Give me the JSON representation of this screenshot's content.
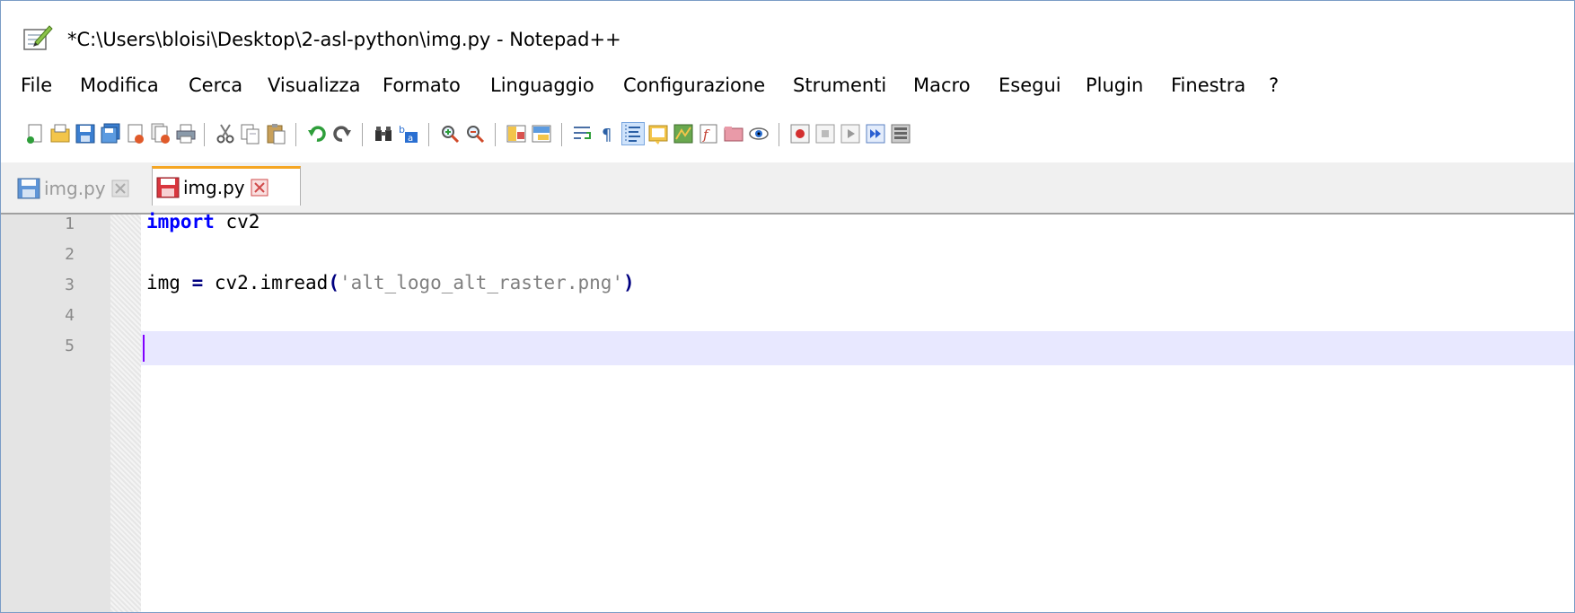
{
  "window": {
    "title": "*C:\\Users\\bloisi\\Desktop\\2-asl-python\\img.py - Notepad++"
  },
  "menu": {
    "items": [
      "File",
      "Modifica",
      "Cerca",
      "Visualizza",
      "Formato",
      "Linguaggio",
      "Configurazione",
      "Strumenti",
      "Macro",
      "Esegui",
      "Plugin",
      "Finestra",
      "?"
    ]
  },
  "toolbar": {
    "icons": [
      "new-file-icon",
      "open-file-icon",
      "save-icon",
      "save-all-icon",
      "close-icon",
      "close-all-icon",
      "print-icon",
      "cut-icon",
      "copy-icon",
      "paste-icon",
      "undo-icon",
      "redo-icon",
      "find-icon",
      "replace-icon",
      "zoom-in-icon",
      "zoom-out-icon",
      "sync-vertical-icon",
      "sync-horizontal-icon",
      "word-wrap-icon",
      "show-all-chars-icon",
      "indent-guide-icon",
      "user-language-icon",
      "document-map-icon",
      "function-list-icon",
      "folder-workspace-icon",
      "monitoring-icon",
      "record-macro-icon",
      "stop-macro-icon",
      "play-macro-icon",
      "run-macro-multiple-icon",
      "save-macro-icon"
    ]
  },
  "tabs": [
    {
      "label": "img.py",
      "state": "inactive"
    },
    {
      "label": "img.py",
      "state": "active"
    }
  ],
  "editor": {
    "line_numbers": [
      "1",
      "2",
      "3",
      "4",
      "5"
    ],
    "current_line": "5",
    "lines": [
      {
        "tokens": [
          {
            "t": "import",
            "c": "kw"
          },
          {
            "t": " cv2",
            "c": ""
          }
        ]
      },
      {
        "tokens": []
      },
      {
        "tokens": [
          {
            "t": "img ",
            "c": ""
          },
          {
            "t": "=",
            "c": "op"
          },
          {
            "t": " cv2.imread",
            "c": ""
          },
          {
            "t": "(",
            "c": "op"
          },
          {
            "t": "'alt_logo_alt_raster.png'",
            "c": "str"
          },
          {
            "t": ")",
            "c": "op"
          }
        ]
      },
      {
        "tokens": []
      },
      {
        "tokens": []
      }
    ]
  },
  "colors": {
    "current_line_bg": "#e8e8ff",
    "caret": "#8000ff",
    "keyword": "#0000ff",
    "string": "#808080",
    "active_tab_accent": "#f5a623"
  }
}
